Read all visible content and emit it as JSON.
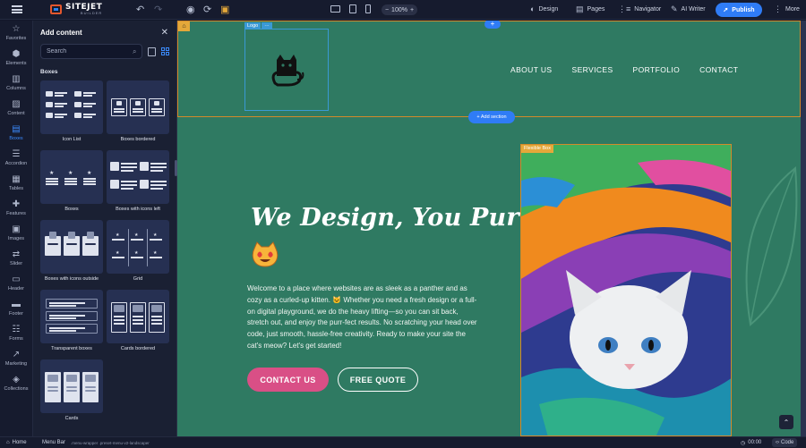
{
  "topbar": {
    "brand_name": "SITEJET",
    "brand_sub": "BUILDER",
    "zoom": "100%",
    "design": "Design",
    "pages": "Pages",
    "navigator": "Navigator",
    "ai_writer": "AI Writer",
    "publish": "Publish",
    "more": "More",
    "accent_color": "#2f7cf6"
  },
  "rail": {
    "items": [
      {
        "label": "Favorites",
        "icon": "star-icon"
      },
      {
        "label": "Elements",
        "icon": "cube-icon"
      },
      {
        "label": "Columns",
        "icon": "columns-icon"
      },
      {
        "label": "Content",
        "icon": "image-text-icon"
      },
      {
        "label": "Boxes",
        "icon": "box-icon"
      },
      {
        "label": "Accordion",
        "icon": "accordion-icon"
      },
      {
        "label": "Tables",
        "icon": "table-icon"
      },
      {
        "label": "Features",
        "icon": "puzzle-icon"
      },
      {
        "label": "Images",
        "icon": "image-icon"
      },
      {
        "label": "Slider",
        "icon": "slider-icon"
      },
      {
        "label": "Header",
        "icon": "header-icon"
      },
      {
        "label": "Footer",
        "icon": "footer-icon"
      },
      {
        "label": "Forms",
        "icon": "form-icon"
      },
      {
        "label": "Marketing",
        "icon": "chart-icon"
      },
      {
        "label": "Collections",
        "icon": "stack-icon"
      }
    ],
    "active": "Boxes"
  },
  "panel": {
    "title": "Add content",
    "search_placeholder": "Search",
    "section": "Boxes",
    "cards": [
      {
        "label": "Icon List"
      },
      {
        "label": "Boxes bordered"
      },
      {
        "label": "Boxes"
      },
      {
        "label": "Boxes with icons left"
      },
      {
        "label": "Boxes with icons outside"
      },
      {
        "label": "Grid"
      },
      {
        "label": "Transparent boxes"
      },
      {
        "label": "Cards bordered"
      },
      {
        "label": "Cards"
      }
    ]
  },
  "canvas": {
    "bg_color": "#2f7a62",
    "logo_tag": "Logo",
    "nav": [
      "ABOUT US",
      "SERVICES",
      "PORTFOLIO",
      "CONTACT"
    ],
    "add_section": "+ Add section",
    "hero_title": "We Design, You Purr",
    "hero_text": "Welcome to a place where websites are as sleek as a panther and as cozy as a curled-up kitten. 🐱 Whether you need a fresh design or a full-on digital playground, we do the heavy lifting—so you can sit back, stretch out, and enjoy the purr-fect results. No scratching your head over code, just smooth, hassle-free creativity. Ready to make your site the cat's meow? Let's get started!",
    "btn_contact": "CONTACT US",
    "btn_quote": "FREE QUOTE",
    "flex_tag": "Flexible Box",
    "contact_color": "#d94f86"
  },
  "status": {
    "home": "Home",
    "menu": "Menu Bar",
    "classes": ".menu-wrapper .preset-menu-v2-landscaper",
    "time": "00:00",
    "code": "Code"
  }
}
